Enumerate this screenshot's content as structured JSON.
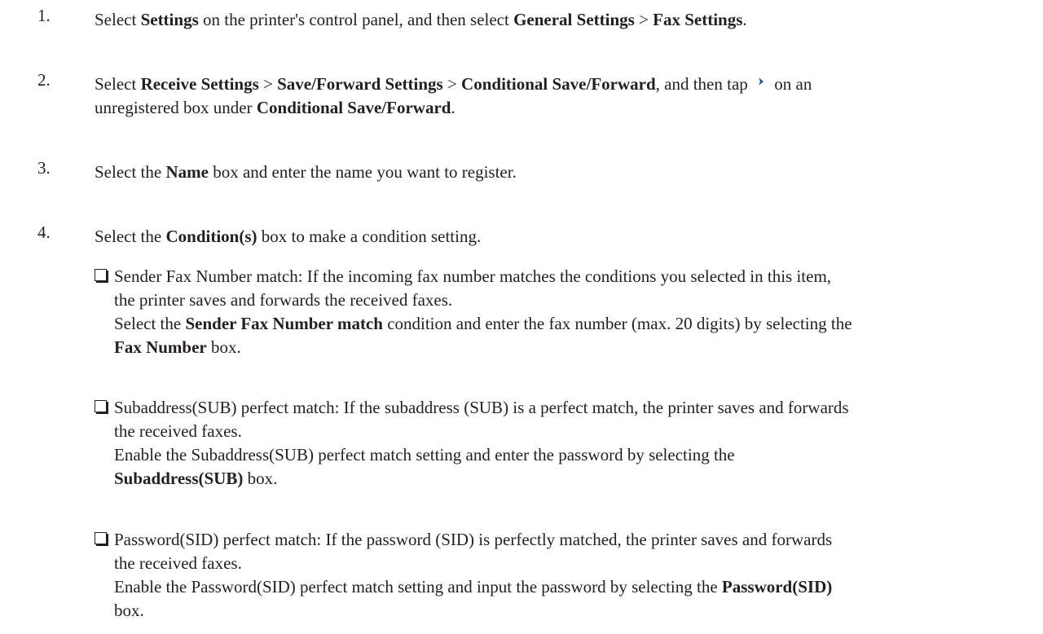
{
  "steps": [
    {
      "num": "1.",
      "t1": "Select ",
      "b1": "Settings",
      "t2": " on the printer's control panel, and then select ",
      "b2": "General Settings",
      "t3": " > ",
      "b3": "Fax Settings",
      "t4": "."
    },
    {
      "num": "2.",
      "t1": "Select ",
      "b1": "Receive Settings",
      "t2": " > ",
      "b2": "Save/Forward Settings",
      "t3": " > ",
      "b3": "Conditional Save/Forward",
      "t4": ", and then tap ",
      "icon": "chevron-right-icon",
      "t5": " on an",
      "line2_t1": "unregistered box under ",
      "line2_b1": "Conditional Save/Forward",
      "line2_t2": "."
    },
    {
      "num": "3.",
      "t1": "Select the ",
      "b1": "Name",
      "t2": " box and enter the name you want to register."
    },
    {
      "num": "4.",
      "t1": "Select the ",
      "b1": "Condition(s)",
      "t2": " box to make a condition setting."
    }
  ],
  "conditions": [
    {
      "desc_l1": "Sender Fax Number match: If the incoming fax number matches the conditions you selected in this item,",
      "desc_l2": "the printer saves and forwards the received faxes.",
      "sub_t1": "Select the ",
      "sub_b1": "Sender Fax Number match",
      "sub_t2": " condition and enter the fax number (max. 20 digits) by selecting the",
      "sub_b2": "Fax Number",
      "sub_t3": " box."
    },
    {
      "desc_l1": "Subaddress(SUB) perfect match: If the subaddress (SUB) is a perfect match, the printer saves and forwards",
      "desc_l2": "the received faxes.",
      "sub_t1": "Enable the Subaddress(SUB) perfect match setting and enter the password by selecting the",
      "sub_b2": "Subaddress(SUB)",
      "sub_t3": " box."
    },
    {
      "desc_l1": "Password(SID) perfect match: If the password (SID) is perfectly matched, the printer saves and forwards",
      "desc_l2": "the received faxes.",
      "sub_t1": "Enable the Password(SID) perfect match setting and input the password by selecting the ",
      "sub_b1": "Password(SID)",
      "sub_t3": "box."
    }
  ],
  "colors": {
    "text": "#231f20",
    "icon": "#1a4fa0"
  }
}
